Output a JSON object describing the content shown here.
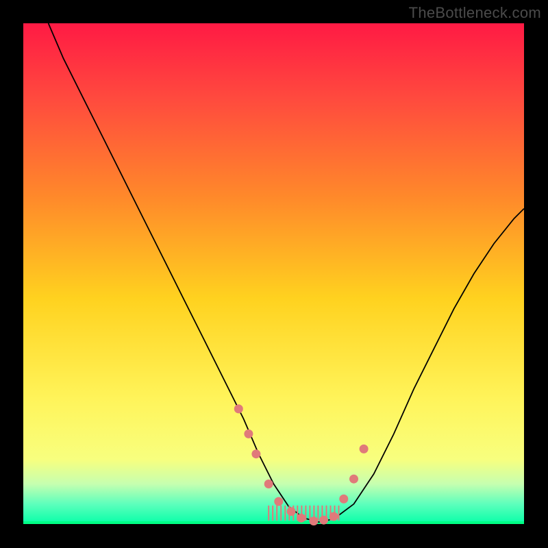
{
  "watermark": "TheBottleneck.com",
  "frame": {
    "outer_w": 800,
    "outer_h": 800,
    "border_left": 34,
    "border_right": 35,
    "border_top": 34,
    "border_bottom": 35
  },
  "chart_data": {
    "type": "line",
    "title": "",
    "xlabel": "",
    "ylabel": "",
    "xlim": [
      0,
      100
    ],
    "ylim": [
      0,
      100
    ],
    "grid": false,
    "legend": false,
    "series": [
      {
        "name": "bottleneck-curve",
        "x": [
          5,
          8,
          12,
          16,
          20,
          24,
          28,
          32,
          36,
          40,
          44,
          47,
          50,
          53,
          56,
          59,
          62,
          66,
          70,
          74,
          78,
          82,
          86,
          90,
          94,
          98,
          100
        ],
        "y": [
          100,
          93,
          85,
          77,
          69,
          61,
          53,
          45,
          37,
          29,
          21,
          14,
          8,
          3.5,
          1.2,
          0.4,
          1.0,
          4,
          10,
          18,
          27,
          35,
          43,
          50,
          56,
          61,
          63
        ]
      }
    ],
    "highlight_dots": {
      "comment": "salmon dots near valley on the curve",
      "x": [
        43,
        45,
        46.5,
        49,
        51,
        53.5,
        55.5,
        58,
        60,
        62,
        64,
        66,
        68
      ],
      "y": [
        23,
        18,
        14,
        8,
        4.5,
        2.5,
        1.2,
        0.6,
        0.8,
        1.5,
        5,
        9,
        15
      ]
    },
    "bottom_hatch": {
      "comment": "short salmon strokes just above green band between dots",
      "x_start": 49,
      "x_end": 63,
      "y": 1.5,
      "count": 18
    }
  }
}
